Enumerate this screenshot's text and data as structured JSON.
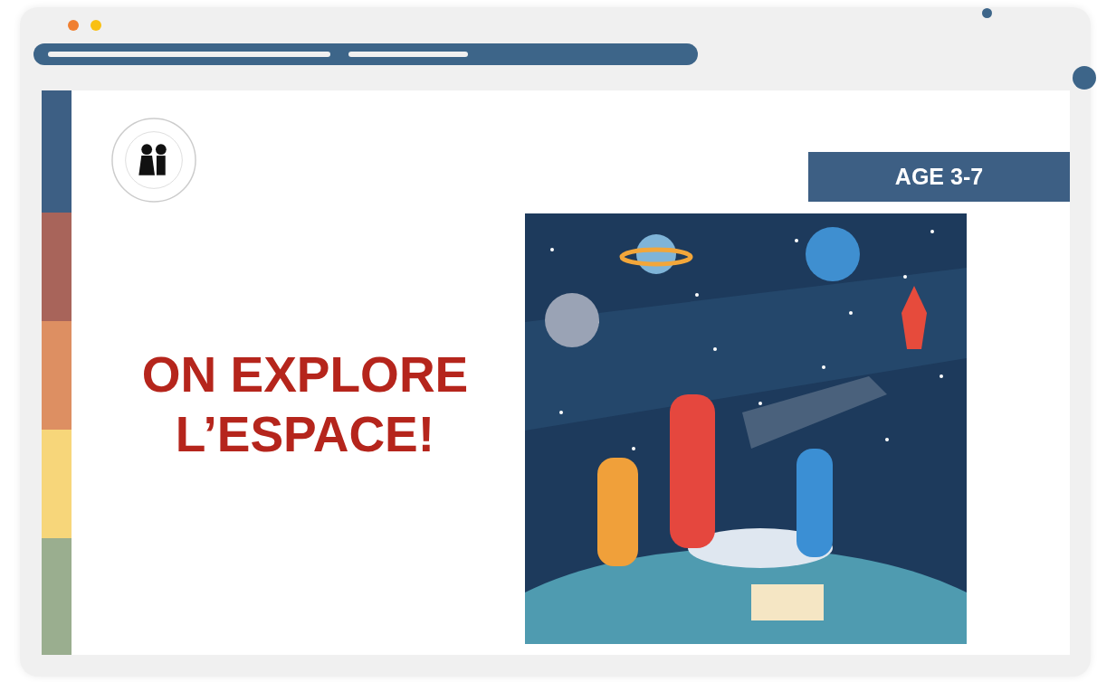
{
  "window": {
    "controls": [
      {
        "color": "#f07f30"
      },
      {
        "color": "#f9c012"
      }
    ]
  },
  "slide": {
    "stripes": [
      {
        "color": "#3d5f84"
      },
      {
        "color": "#a8645a"
      },
      {
        "color": "#dd8f62"
      },
      {
        "color": "#f7d67a"
      },
      {
        "color": "#9aae8f"
      }
    ],
    "title": [
      "ON EXPLORE",
      "L’ESPACE!"
    ],
    "badge": "AGE 3-7"
  }
}
